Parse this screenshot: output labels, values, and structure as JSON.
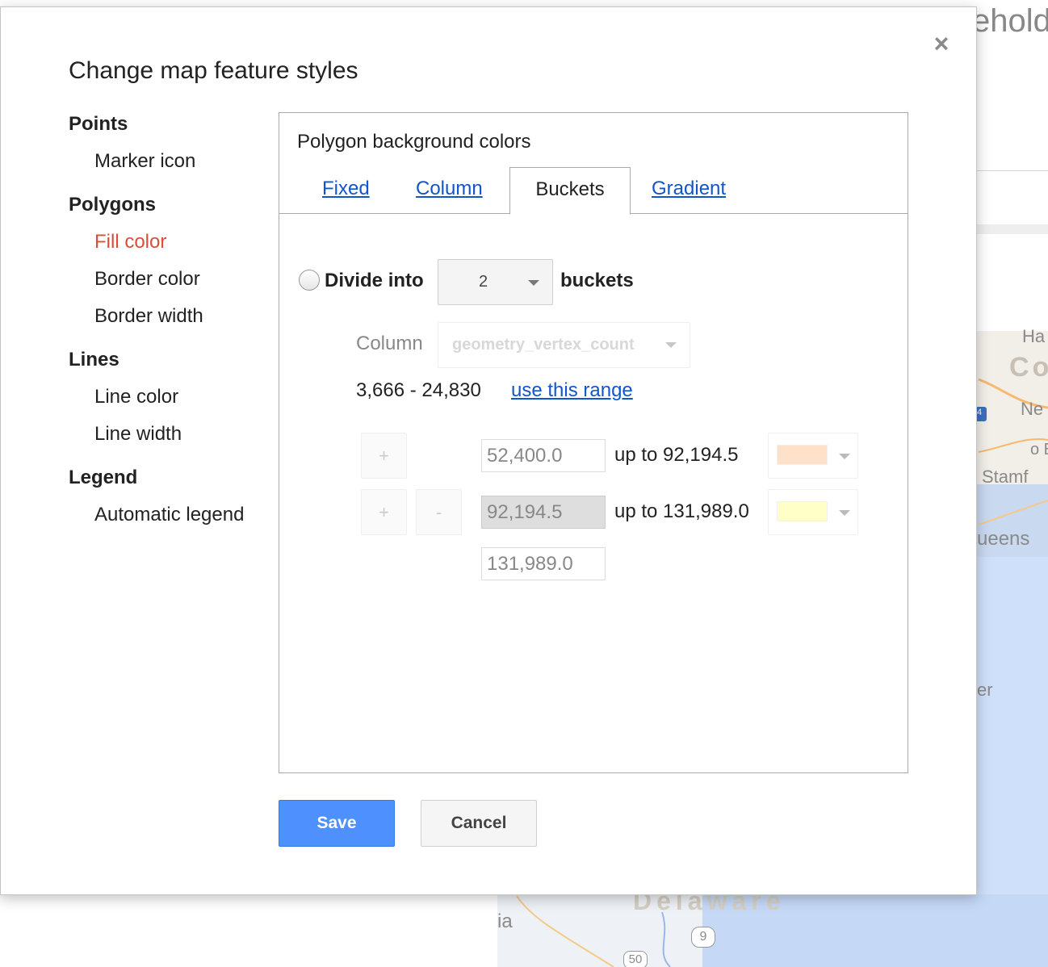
{
  "background": {
    "page_title_fragment": "ehold",
    "map_labels": [
      "Ha",
      "Co",
      "Ne",
      "o E",
      "Stamf",
      "ueens",
      "er",
      "ia",
      "Delaware",
      "9",
      "50",
      "4"
    ]
  },
  "dialog": {
    "title": "Change map feature styles",
    "close_glyph": "×"
  },
  "nav": {
    "sections": [
      {
        "label": "Points",
        "items": [
          "Marker icon"
        ]
      },
      {
        "label": "Polygons",
        "items": [
          "Fill color",
          "Border color",
          "Border width"
        ]
      },
      {
        "label": "Lines",
        "items": [
          "Line color",
          "Line width"
        ]
      },
      {
        "label": "Legend",
        "items": [
          "Automatic legend"
        ]
      }
    ],
    "active_item": "Fill color"
  },
  "panel": {
    "heading": "Polygon background colors",
    "tabs": [
      "Fixed",
      "Column",
      "Buckets",
      "Gradient"
    ],
    "active_tab": "Buckets",
    "divide_label": "Divide into",
    "bucket_count": "2",
    "buckets_label": "buckets",
    "column_label": "Column",
    "column_value": "geometry_vertex_count",
    "range": "3,666 - 24,830",
    "range_link": "use this range",
    "rows": [
      {
        "plus": "+",
        "minus": "",
        "value": "52,400.0",
        "upto": "up to 92,194.5",
        "color": "#ffe0c8"
      },
      {
        "plus": "+",
        "minus": "-",
        "value": "92,194.5",
        "upto": "up to 131,989.0",
        "color": "#ffffc8"
      }
    ],
    "last_value": "131,989.0"
  },
  "footer": {
    "save": "Save",
    "cancel": "Cancel"
  },
  "colors": {
    "accent": "#4d90fe",
    "link": "#1155cc",
    "active_nav": "#dd4b39"
  }
}
